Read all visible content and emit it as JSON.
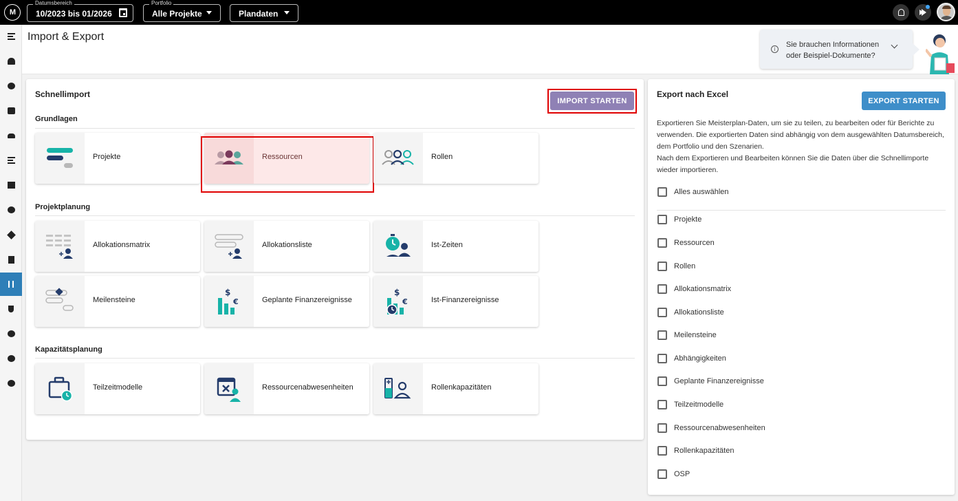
{
  "topbar": {
    "logo_text": "M",
    "date_range": {
      "label": "Datumsbereich",
      "value": "10/2023 bis 01/2026"
    },
    "portfolio": {
      "label": "Portfolio",
      "value": "Alle Projekte"
    },
    "data_type": {
      "value": "Plandaten"
    }
  },
  "header": {
    "title": "Import & Export",
    "info_text": "Sie brauchen Informationen oder Beispiel-Dokumente?",
    "info_symbol": "i"
  },
  "import": {
    "title": "Schnellimport",
    "start_button": "IMPORT STARTEN",
    "sections": [
      {
        "label": "Grundlagen",
        "tiles": [
          "Projekte",
          "Ressourcen",
          "Rollen"
        ]
      },
      {
        "label": "Projektplanung",
        "tiles": [
          "Allokationsmatrix",
          "Allokationsliste",
          "Ist-Zeiten",
          "Meilensteine",
          "Geplante Finanzereignisse",
          "Ist-Finanzereignisse"
        ]
      },
      {
        "label": "Kapazitätsplanung",
        "tiles": [
          "Teilzeitmodelle",
          "Ressourcenabwesenheiten",
          "Rollenkapazitäten"
        ]
      }
    ],
    "selected_tile": "Ressourcen"
  },
  "export": {
    "title": "Export nach Excel",
    "start_button": "EXPORT STARTEN",
    "description": "Exportieren Sie Meisterplan-Daten, um sie zu teilen, zu bearbeiten oder für Berichte zu verwenden. Die exportierten Daten sind abhängig von dem ausgewählten Datumsbereich, dem Portfolio und den Szenarien.",
    "description2": "Nach dem Exportieren und Bearbeiten können Sie die Daten über die Schnellimporte wieder importieren.",
    "select_all": "Alles auswählen",
    "items": [
      "Projekte",
      "Ressourcen",
      "Rollen",
      "Allokationsmatrix",
      "Allokationsliste",
      "Meilensteine",
      "Abhängigkeiten",
      "Geplante Finanzereignisse",
      "Teilzeitmodelle",
      "Ressourcenabwesenheiten",
      "Rollenkapazitäten",
      "OSP"
    ]
  },
  "colors": {
    "accent": "#2e7fb8",
    "import_button": "#8f81b5",
    "export_button": "#3e8ec9",
    "teal": "#17b3a8",
    "navy": "#243c6b",
    "highlight": "#e00000"
  },
  "icons": [
    "menu-icon",
    "resource-icon",
    "chart-icon",
    "contact-icon",
    "people-icon",
    "list-icon",
    "board-icon",
    "target-icon",
    "direction-icon",
    "document-icon",
    "import-export-icon",
    "plug-icon",
    "gear-icon",
    "help-icon",
    "compass-icon",
    "bell-icon",
    "megaphone-icon",
    "calendar-icon"
  ]
}
